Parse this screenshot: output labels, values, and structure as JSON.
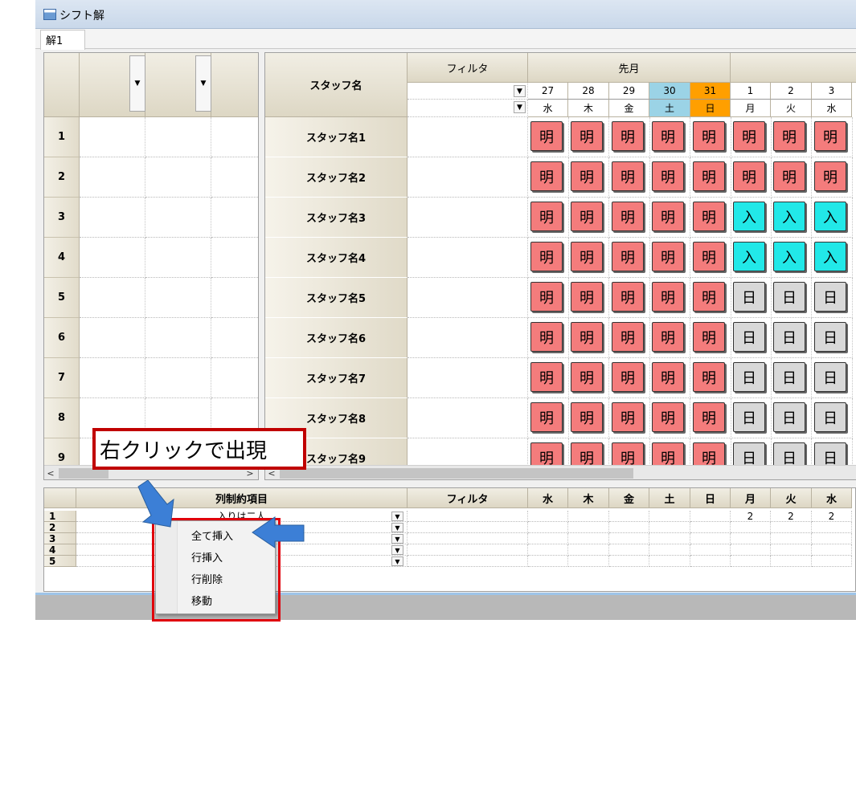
{
  "window": {
    "title": "シフト解"
  },
  "tabs": [
    {
      "label": "解1"
    }
  ],
  "grid": {
    "staff_header": "スタッフ名",
    "filter_header": "フィルタ",
    "month_header": "先月",
    "days": [
      {
        "date": "27",
        "dow": "水",
        "kind": "normal"
      },
      {
        "date": "28",
        "dow": "木",
        "kind": "normal"
      },
      {
        "date": "29",
        "dow": "金",
        "kind": "normal"
      },
      {
        "date": "30",
        "dow": "土",
        "kind": "sat"
      },
      {
        "date": "31",
        "dow": "日",
        "kind": "sun"
      },
      {
        "date": "1",
        "dow": "月",
        "kind": "normal"
      },
      {
        "date": "2",
        "dow": "火",
        "kind": "normal"
      },
      {
        "date": "3",
        "dow": "水",
        "kind": "normal"
      }
    ],
    "rows": [
      {
        "no": "1",
        "name": "スタッフ名1",
        "shifts": [
          "明",
          "明",
          "明",
          "明",
          "明",
          "明",
          "明",
          "明"
        ]
      },
      {
        "no": "2",
        "name": "スタッフ名2",
        "shifts": [
          "明",
          "明",
          "明",
          "明",
          "明",
          "明",
          "明",
          "明"
        ]
      },
      {
        "no": "3",
        "name": "スタッフ名3",
        "shifts": [
          "明",
          "明",
          "明",
          "明",
          "明",
          "入",
          "入",
          "入"
        ]
      },
      {
        "no": "4",
        "name": "スタッフ名4",
        "shifts": [
          "明",
          "明",
          "明",
          "明",
          "明",
          "入",
          "入",
          "入"
        ]
      },
      {
        "no": "5",
        "name": "スタッフ名5",
        "shifts": [
          "明",
          "明",
          "明",
          "明",
          "明",
          "日",
          "日",
          "日"
        ]
      },
      {
        "no": "6",
        "name": "スタッフ名6",
        "shifts": [
          "明",
          "明",
          "明",
          "明",
          "明",
          "日",
          "日",
          "日"
        ]
      },
      {
        "no": "7",
        "name": "スタッフ名7",
        "shifts": [
          "明",
          "明",
          "明",
          "明",
          "明",
          "日",
          "日",
          "日"
        ]
      },
      {
        "no": "8",
        "name": "スタッフ名8",
        "shifts": [
          "明",
          "明",
          "明",
          "明",
          "明",
          "日",
          "日",
          "日"
        ]
      },
      {
        "no": "9",
        "name": "スタッフ名9",
        "shifts": [
          "明",
          "明",
          "明",
          "明",
          "明",
          "日",
          "日",
          "日"
        ]
      }
    ],
    "shift_colors": {
      "明": "#f47c7c",
      "入": "#22e8e8",
      "日": "#d8d8d8"
    },
    "day_colors": {
      "sat": "#9bd3e6",
      "sun": "#ff9f00"
    }
  },
  "constraints": {
    "item_header": "列制約項目",
    "filter_header": "フィルタ",
    "dow_headers": [
      "水",
      "木",
      "金",
      "土",
      "日",
      "月",
      "火",
      "水"
    ],
    "rows": [
      {
        "no": "1",
        "item": "入りは二人",
        "values": [
          "",
          "",
          "",
          "",
          "",
          "2",
          "2",
          "2"
        ]
      },
      {
        "no": "2",
        "item": "",
        "values": [
          "",
          "",
          "",
          "",
          "",
          "",
          "",
          ""
        ]
      },
      {
        "no": "3",
        "item": "",
        "values": [
          "",
          "",
          "",
          "",
          "",
          "",
          "",
          ""
        ]
      },
      {
        "no": "4",
        "item": "",
        "values": [
          "",
          "",
          "",
          "",
          "",
          "",
          "",
          ""
        ]
      },
      {
        "no": "5",
        "item": "",
        "values": [
          "",
          "",
          "",
          "",
          "",
          "",
          "",
          ""
        ]
      }
    ]
  },
  "context_menu": {
    "items": [
      "全て挿入",
      "行挿入",
      "行削除",
      "移動"
    ]
  },
  "callout": {
    "text": "右クリックで出現"
  },
  "icons": {
    "dropdown": "dropdown-arrow-icon",
    "scroll_left": "scroll-left-icon",
    "scroll_right": "scroll-right-icon",
    "app": "app-window-icon"
  }
}
